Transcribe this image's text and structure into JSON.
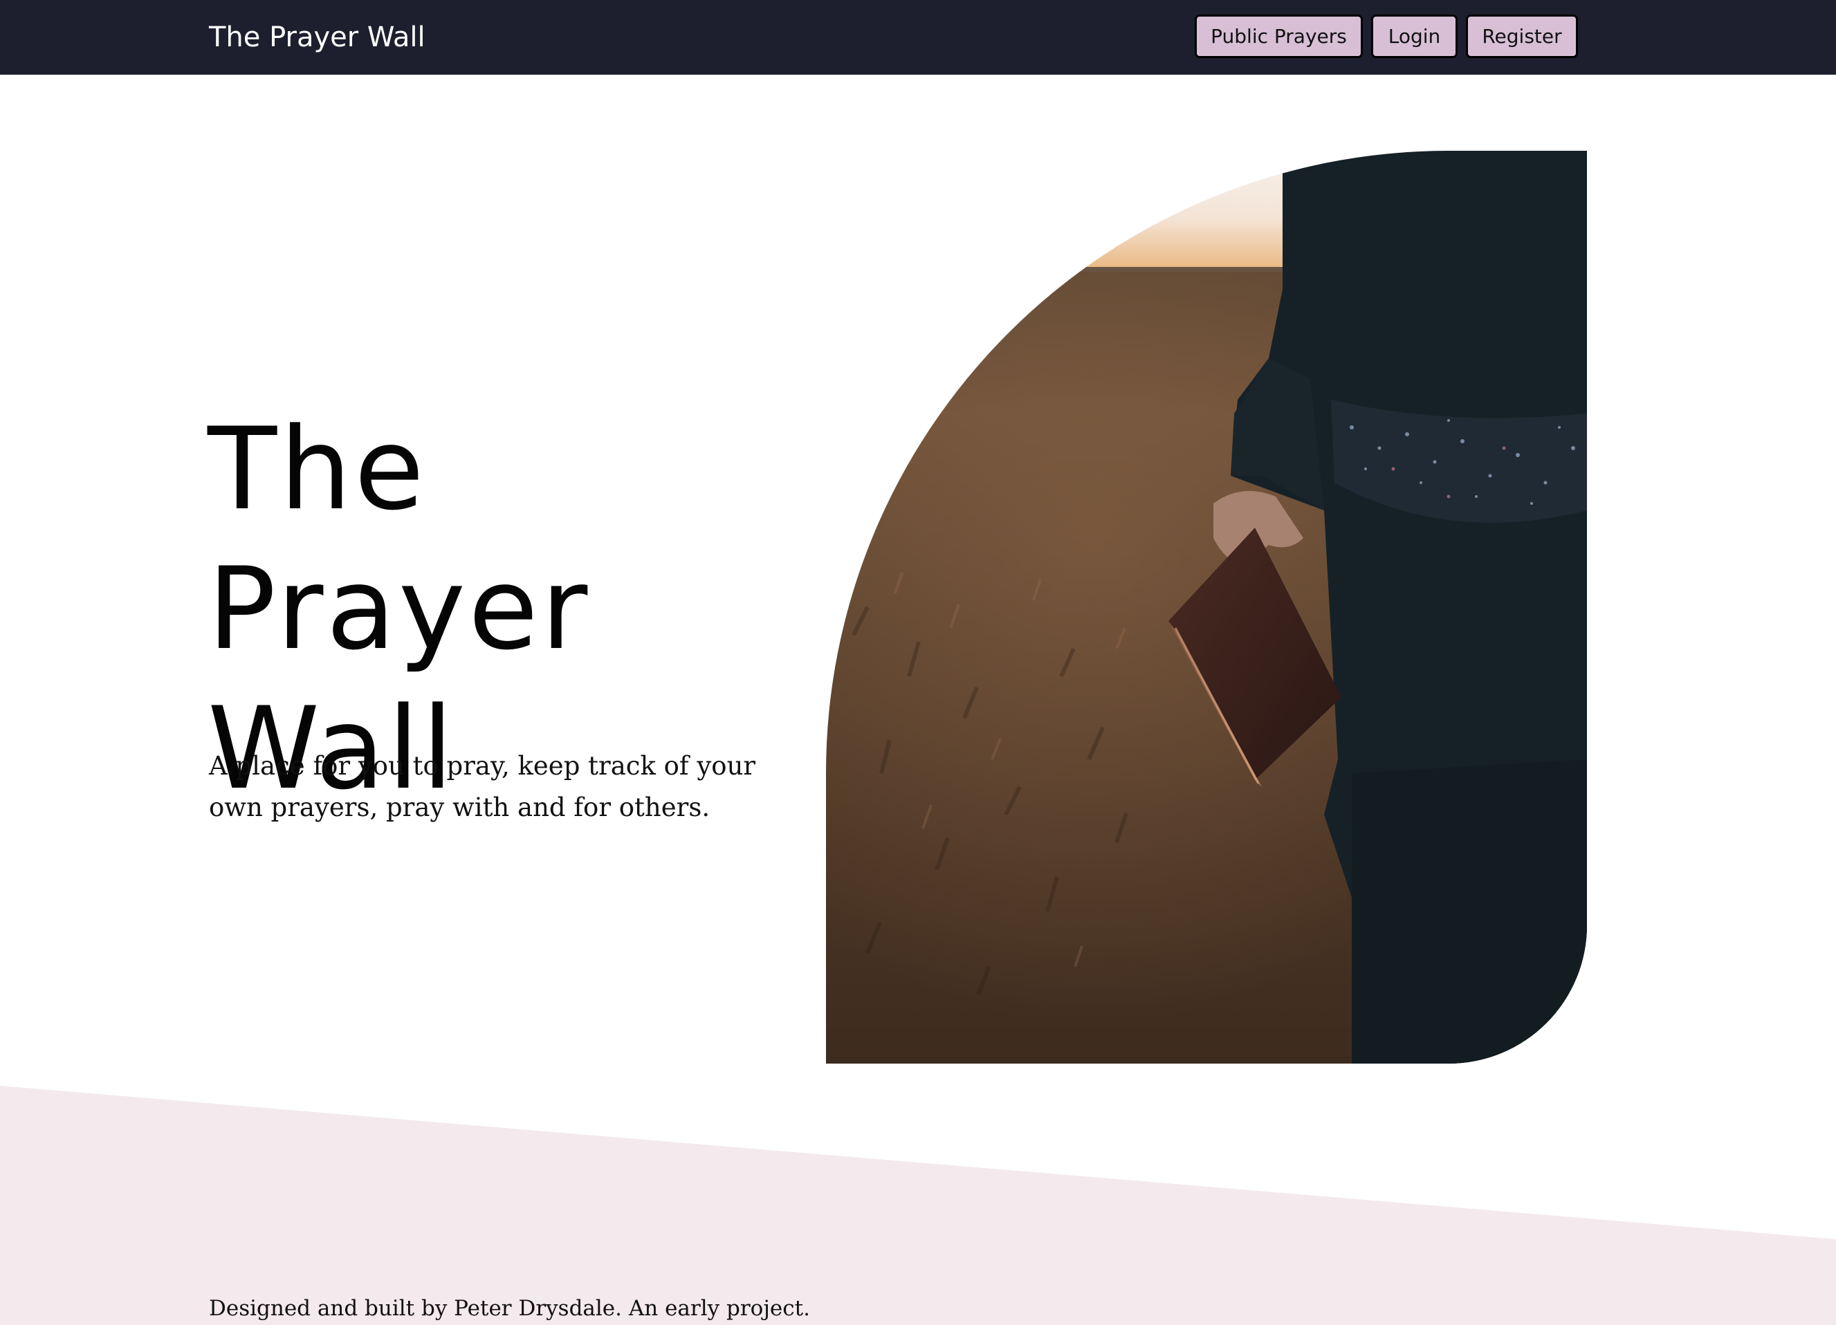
{
  "navbar": {
    "brand": "The Prayer Wall",
    "buttons": {
      "public_prayers": "Public Prayers",
      "login": "Login",
      "register": "Register"
    }
  },
  "hero": {
    "title_line1": "The Prayer",
    "title_line2": "Wall",
    "description": "A place for you to pray, keep track of your own prayers, pray with and for others.",
    "image_alt": "Person holding a bible in a field at sunset"
  },
  "footer": {
    "text": "Designed and built by Peter Drysdale. An early project."
  },
  "colors": {
    "navbar_bg": "#1e1f2e",
    "button_bg": "#d8bfd6",
    "footer_bg": "#f4e9ec",
    "text": "#050505"
  }
}
